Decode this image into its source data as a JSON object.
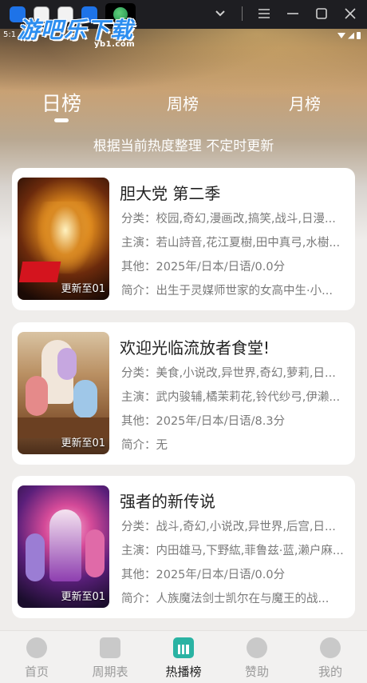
{
  "window": {
    "logo_text": "游吧乐下载",
    "logo_sub": "yb1.com"
  },
  "status": {
    "time": "5:1"
  },
  "tabs": [
    {
      "label": "日榜",
      "active": true
    },
    {
      "label": "周榜",
      "active": false
    },
    {
      "label": "月榜",
      "active": false
    }
  ],
  "subtitle": "根据当前热度整理 不定时更新",
  "items": [
    {
      "title": "胆大党 第二季",
      "genre": "分类：校园,奇幻,漫画改,搞笑,战斗,日漫...",
      "cast": "主演：若山詩音,花江夏樹,田中真弓,水樹...",
      "other": "其他：2025年/日本/日语/0.0分",
      "intro": "简介：出生于灵媒师世家的女高中生·小...",
      "badge": "更新至01"
    },
    {
      "title": "欢迎光临流放者食堂!",
      "genre": "分类：美食,小说改,异世界,奇幻,萝莉,日...",
      "cast": "主演：武内骏辅,橘茉莉花,铃代纱弓,伊濑...",
      "other": "其他：2025年/日本/日语/8.3分",
      "intro": "简介：无",
      "badge": "更新至01"
    },
    {
      "title": "强者的新传说",
      "genre": "分类：战斗,奇幻,小说改,异世界,后宫,日...",
      "cast": "主演：内田雄马,下野紘,菲鲁兹·蓝,濑户麻...",
      "other": "其他：2025年/日本/日语/0.0分",
      "intro": "简介：人族魔法剑士凯尔在与魔王的战...",
      "badge": "更新至01"
    }
  ],
  "bottom_nav": [
    {
      "label": "首页",
      "icon": "home-icon"
    },
    {
      "label": "周期表",
      "icon": "calendar-icon"
    },
    {
      "label": "热播榜",
      "icon": "chart-icon",
      "active": true
    },
    {
      "label": "赞助",
      "icon": "sponsor-icon"
    },
    {
      "label": "我的",
      "icon": "profile-icon"
    }
  ],
  "colors": {
    "accent": "#2ab3a3",
    "logo_blue": "#2c8ef0"
  }
}
